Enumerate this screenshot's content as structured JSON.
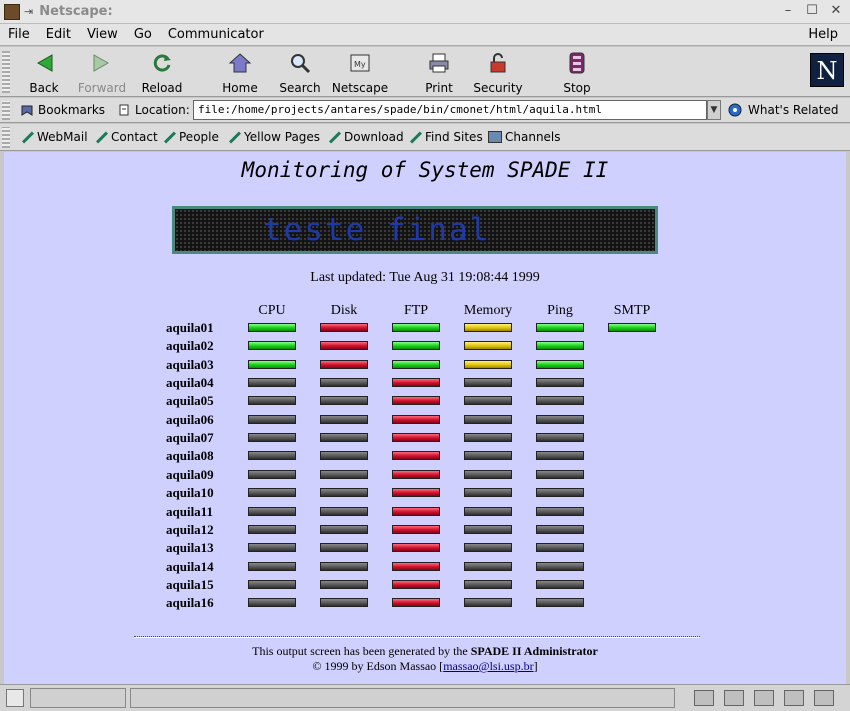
{
  "window": {
    "title": "Netscape:"
  },
  "menu": [
    "File",
    "Edit",
    "View",
    "Go",
    "Communicator"
  ],
  "menu_help": "Help",
  "nav": {
    "back": "Back",
    "forward": "Forward",
    "reload": "Reload",
    "home": "Home",
    "search": "Search",
    "netscape": "Netscape",
    "print": "Print",
    "security": "Security",
    "stop": "Stop",
    "logo": "N"
  },
  "location": {
    "bookmarks": "Bookmarks",
    "label": "Location:",
    "url": "file:/home/projects/antares/spade/bin/cmonet/html/aquila.html",
    "whats_related": "What's Related"
  },
  "personal": [
    "WebMail",
    "Contact",
    "People",
    "Yellow Pages",
    "Download",
    "Find Sites",
    "Channels"
  ],
  "page": {
    "title": "Monitoring of System SPADE II",
    "ticker": "teste final",
    "last_updated": "Last updated: Tue Aug 31 19:08:44 1999",
    "columns": [
      "CPU",
      "Disk",
      "FTP",
      "Memory",
      "Ping",
      "SMTP"
    ],
    "status_colors": {
      "green": "#18d018",
      "red": "#d0102c",
      "yellow": "#e0c40a",
      "gray": "#585858"
    },
    "hosts": [
      {
        "name": "aquila01",
        "status": [
          "green",
          "red",
          "green",
          "yellow",
          "green",
          "green"
        ]
      },
      {
        "name": "aquila02",
        "status": [
          "green",
          "red",
          "green",
          "yellow",
          "green",
          null
        ]
      },
      {
        "name": "aquila03",
        "status": [
          "green",
          "red",
          "green",
          "yellow",
          "green",
          null
        ]
      },
      {
        "name": "aquila04",
        "status": [
          "gray",
          "gray",
          "red",
          "gray",
          "gray",
          null
        ]
      },
      {
        "name": "aquila05",
        "status": [
          "gray",
          "gray",
          "red",
          "gray",
          "gray",
          null
        ]
      },
      {
        "name": "aquila06",
        "status": [
          "gray",
          "gray",
          "red",
          "gray",
          "gray",
          null
        ]
      },
      {
        "name": "aquila07",
        "status": [
          "gray",
          "gray",
          "red",
          "gray",
          "gray",
          null
        ]
      },
      {
        "name": "aquila08",
        "status": [
          "gray",
          "gray",
          "red",
          "gray",
          "gray",
          null
        ]
      },
      {
        "name": "aquila09",
        "status": [
          "gray",
          "gray",
          "red",
          "gray",
          "gray",
          null
        ]
      },
      {
        "name": "aquila10",
        "status": [
          "gray",
          "gray",
          "red",
          "gray",
          "gray",
          null
        ]
      },
      {
        "name": "aquila11",
        "status": [
          "gray",
          "gray",
          "red",
          "gray",
          "gray",
          null
        ]
      },
      {
        "name": "aquila12",
        "status": [
          "gray",
          "gray",
          "red",
          "gray",
          "gray",
          null
        ]
      },
      {
        "name": "aquila13",
        "status": [
          "gray",
          "gray",
          "red",
          "gray",
          "gray",
          null
        ]
      },
      {
        "name": "aquila14",
        "status": [
          "gray",
          "gray",
          "red",
          "gray",
          "gray",
          null
        ]
      },
      {
        "name": "aquila15",
        "status": [
          "gray",
          "gray",
          "red",
          "gray",
          "gray",
          null
        ]
      },
      {
        "name": "aquila16",
        "status": [
          "gray",
          "gray",
          "red",
          "gray",
          "gray",
          null
        ]
      }
    ],
    "footer_line1_prefix": "This output screen has been generated by the ",
    "footer_line1_bold": "SPADE II Administrator",
    "footer_line2_prefix": "© 1999 by Edson Massao [",
    "footer_email": "massao@lsi.usp.br",
    "footer_line2_suffix": "]"
  }
}
